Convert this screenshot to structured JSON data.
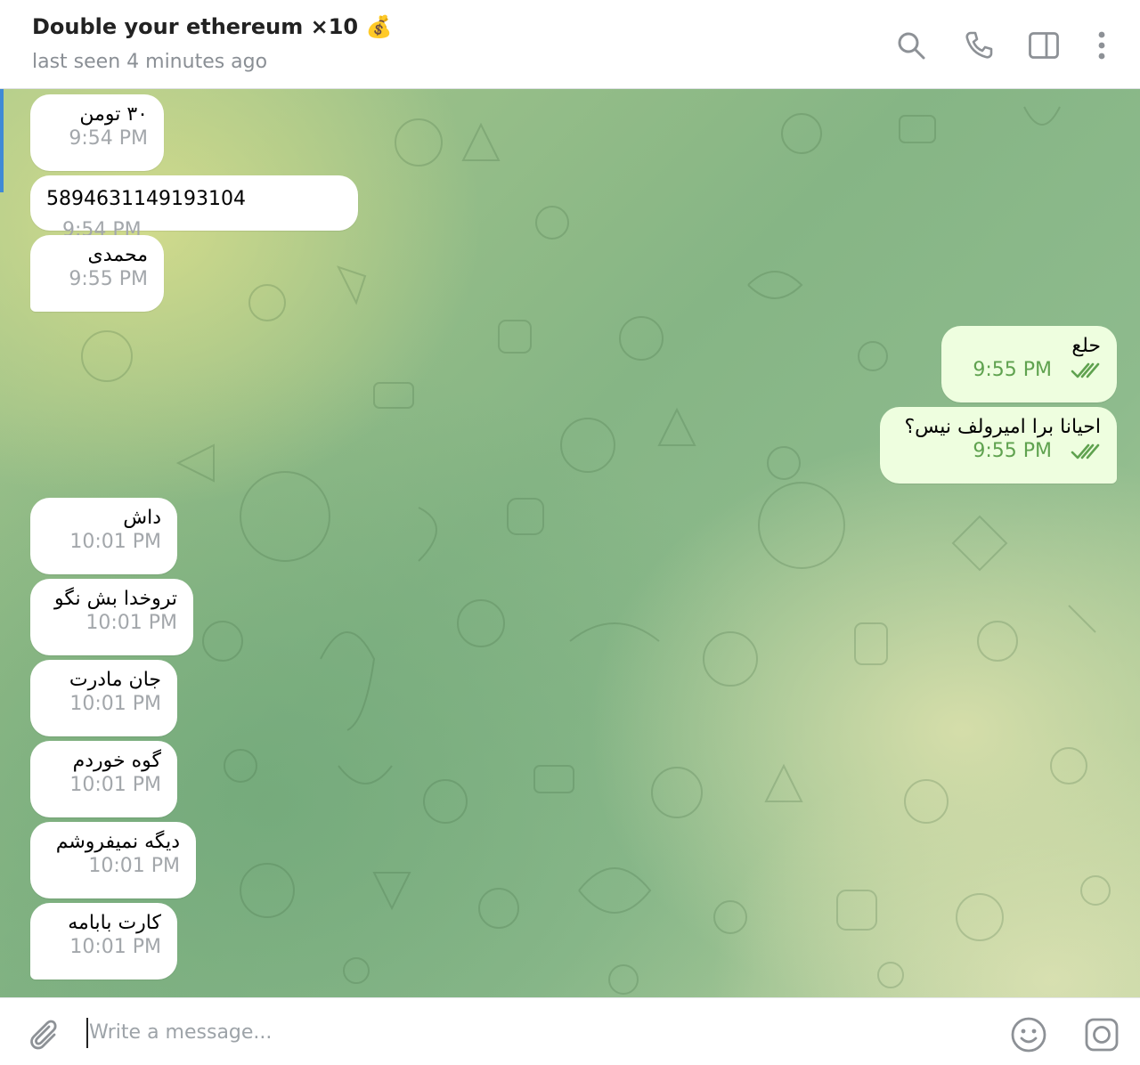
{
  "header": {
    "title": "Double your ethereum ×10",
    "title_emoji": "💰",
    "status": "last seen 4 minutes ago",
    "icons": [
      "search-icon",
      "phone-icon",
      "sidebar-toggle-icon",
      "more-vertical-icon"
    ]
  },
  "messages": [
    {
      "dir": "in",
      "text": "۳۰ تومن",
      "time": "9:54 PM"
    },
    {
      "dir": "in",
      "text": "5894631149193104",
      "time": "9:54 PM"
    },
    {
      "dir": "in",
      "text": "محمدی",
      "time": "9:55 PM"
    },
    {
      "dir": "out",
      "text": "حلع",
      "time": "9:55 PM",
      "read": true
    },
    {
      "dir": "out",
      "text": "احیانا برا امیرولف نیس؟",
      "time": "9:55 PM",
      "read": true
    },
    {
      "dir": "in",
      "text": "داش",
      "time": "10:01 PM"
    },
    {
      "dir": "in",
      "text": "تروخدا بش نگو",
      "time": "10:01 PM"
    },
    {
      "dir": "in",
      "text": "جان مادرت",
      "time": "10:01 PM"
    },
    {
      "dir": "in",
      "text": "گوه خوردم",
      "time": "10:01 PM"
    },
    {
      "dir": "in",
      "text": "دیگه نمیفروشم",
      "time": "10:01 PM"
    },
    {
      "dir": "in",
      "text": "کارت بابامه",
      "time": "10:01 PM"
    }
  ],
  "composer": {
    "placeholder": "Write a message...",
    "icons": [
      "attach-icon",
      "emoji-icon",
      "camera-icon"
    ]
  },
  "colors": {
    "incoming_bubble": "#ffffff",
    "outgoing_bubble": "#eefedf",
    "outgoing_time": "#5fa24f",
    "incoming_time": "#a3a7ab",
    "accent": "#3f8ad6"
  }
}
